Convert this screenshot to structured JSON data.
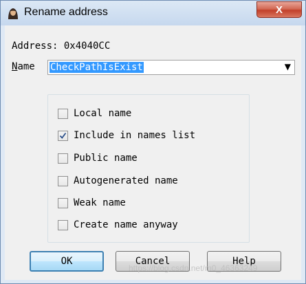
{
  "window": {
    "title": "Rename address",
    "close_label": "X"
  },
  "address": {
    "text": "Address: 0x4040CC"
  },
  "name": {
    "label_mnemonic": "N",
    "label_rest": "ame",
    "value": "CheckPathIsExist"
  },
  "flags": [
    {
      "label": "Local name",
      "checked": false
    },
    {
      "label": "Include in names list",
      "checked": true
    },
    {
      "label": "Public name",
      "checked": false
    },
    {
      "label": "Autogenerated name",
      "checked": false
    },
    {
      "label": "Weak name",
      "checked": false
    },
    {
      "label": "Create name anyway",
      "checked": false
    }
  ],
  "buttons": {
    "ok": "OK",
    "cancel": "Cancel",
    "help": "Help"
  },
  "watermark": "https://blog.csdn.net/m0_46363249"
}
